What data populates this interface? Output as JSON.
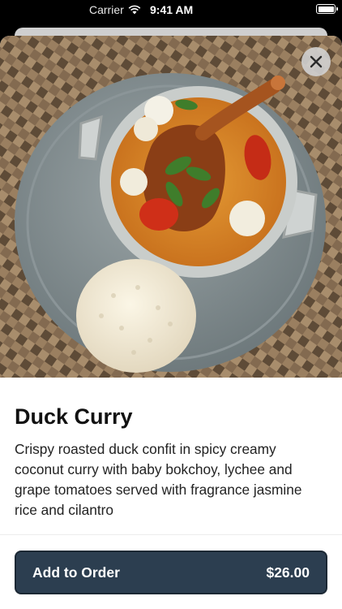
{
  "status_bar": {
    "carrier": "Carrier",
    "time": "9:41 AM"
  },
  "item": {
    "title": "Duck Curry",
    "description": "Crispy roasted duck confit in spicy creamy coconut curry with baby bokchoy, lychee and grape tomatoes served with fragrance jasmine rice and cilantro"
  },
  "actions": {
    "add_label": "Add to Order",
    "price": "$26.00"
  },
  "colors": {
    "button": "#2c3e50",
    "sheet": "#ffffff"
  },
  "icons": {
    "close": "close-icon",
    "wifi": "wifi-icon",
    "battery": "battery-icon"
  }
}
